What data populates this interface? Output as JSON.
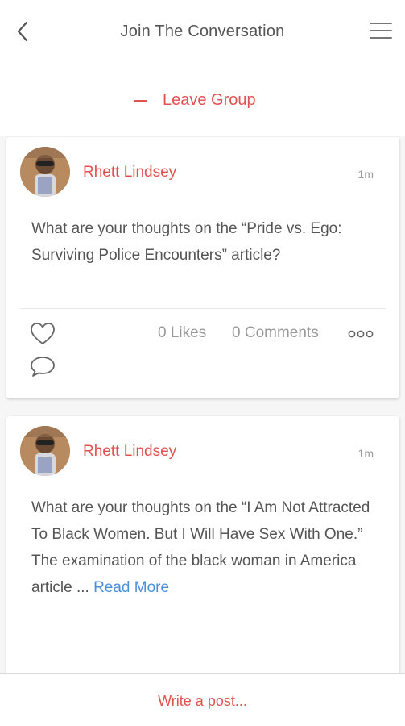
{
  "header": {
    "title": "Join The Conversation",
    "back_icon": "chevron-left-icon",
    "menu_icon": "hamburger-menu-icon"
  },
  "group_action": {
    "leave_label": "Leave Group",
    "leave_icon": "minus-icon"
  },
  "posts": [
    {
      "author": "Rhett Lindsey",
      "time": "1m",
      "text": "What are your thoughts on the “Pride vs. Ego: Surviving Police Encounters” article?",
      "likes_label": "0 Likes",
      "comments_label": "0 Comments"
    },
    {
      "author": "Rhett Lindsey",
      "time": "1m",
      "text_line1": "What are your thoughts on the “I Am Not Attracted To Black Women. But I Will Have Sex With One.”",
      "text_line2": "The examination of the black woman in America article ... ",
      "read_more": "Read More"
    }
  ],
  "footer": {
    "write_post_label": "Write a post..."
  },
  "colors": {
    "accent": "#e0524f",
    "link": "#4a90d9",
    "text": "#555555",
    "muted": "#999999"
  }
}
